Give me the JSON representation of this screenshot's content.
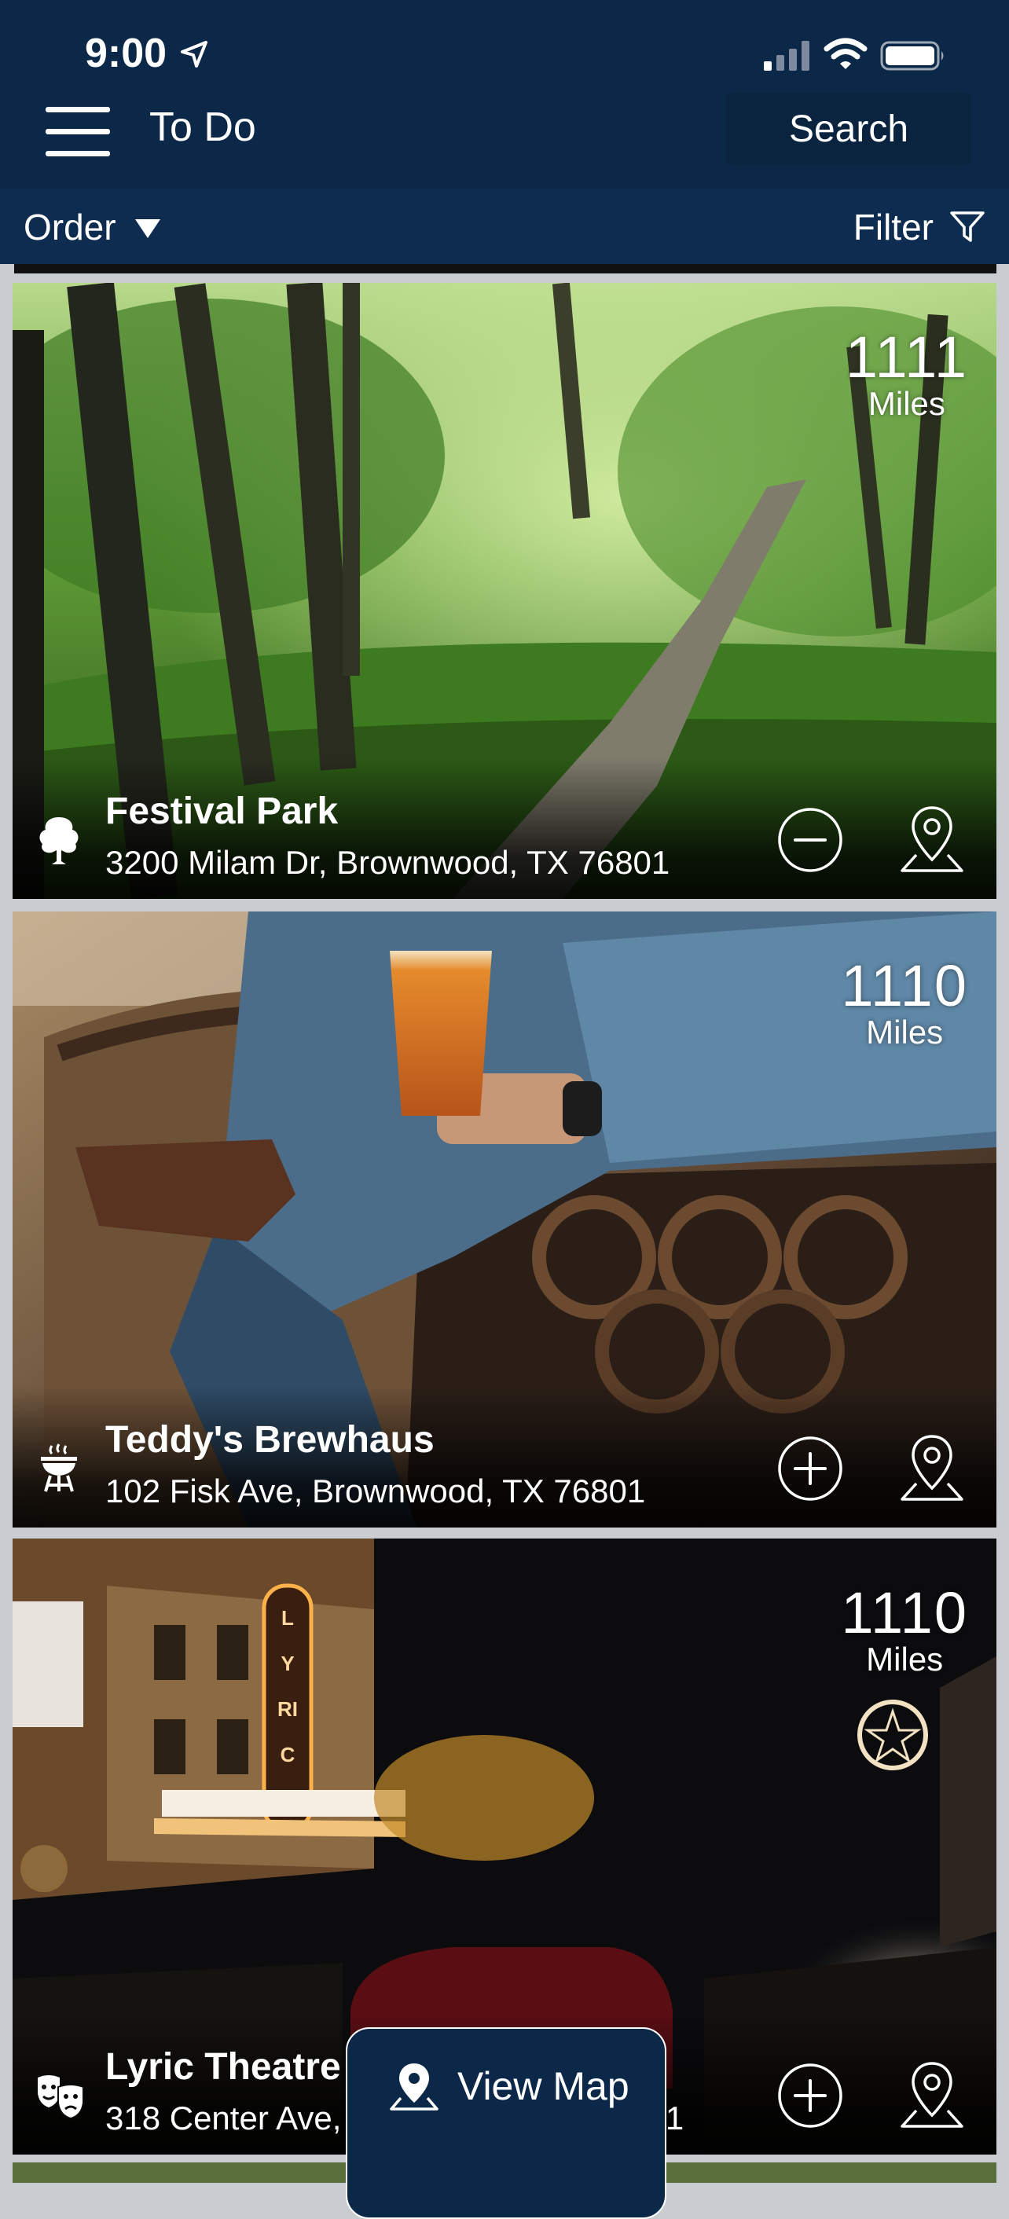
{
  "status_bar": {
    "time": "9:00"
  },
  "header": {
    "title": "To Do",
    "search_label": "Search"
  },
  "subbar": {
    "order_label": "Order",
    "filter_label": "Filter"
  },
  "cards": [
    {
      "distance": "1111",
      "distance_unit": "Miles",
      "name": "Festival Park",
      "address": "3200 Milam Dr, Brownwood, TX 76801",
      "category_icon": "tree-icon",
      "action_icon": "minus-circle-icon"
    },
    {
      "distance": "1110",
      "distance_unit": "Miles",
      "name": "Teddy's Brewhaus",
      "address": "102 Fisk Ave, Brownwood, TX 76801",
      "category_icon": "grill-icon",
      "action_icon": "plus-circle-icon"
    },
    {
      "distance": "1110",
      "distance_unit": "Miles",
      "name": "Lyric Theatre",
      "address": "318 Center Ave, Brownwood, TX 76801",
      "category_icon": "theater-masks-icon",
      "action_icon": "plus-circle-icon",
      "marquee": "LYRIC"
    }
  ],
  "view_map": {
    "label": "View Map"
  }
}
